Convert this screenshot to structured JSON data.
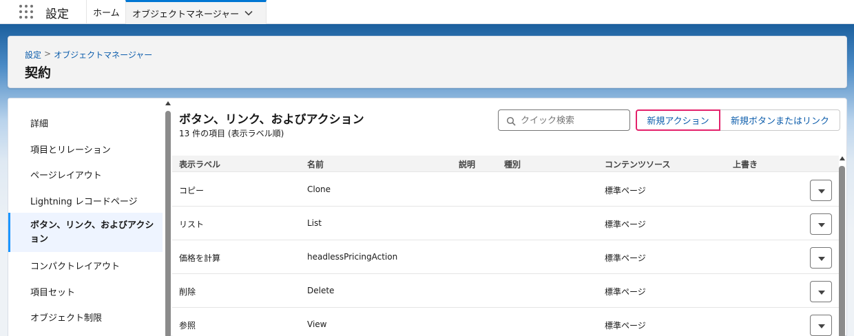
{
  "topbar": {
    "app_name": "設定",
    "tabs": [
      {
        "label": "ホーム"
      },
      {
        "label": "オブジェクトマネージャー"
      }
    ]
  },
  "header": {
    "breadcrumb": [
      {
        "label": "設定"
      },
      {
        "label": "オブジェクトマネージャー"
      }
    ],
    "breadcrumb_sep": ">",
    "title": "契約"
  },
  "sidebar": {
    "items": [
      {
        "label": "詳細"
      },
      {
        "label": "項目とリレーション"
      },
      {
        "label": "ページレイアウト"
      },
      {
        "label": "Lightning レコードページ"
      },
      {
        "label": "ボタン、リンク、およびアクション"
      },
      {
        "label": "コンパクトレイアウト"
      },
      {
        "label": "項目セット"
      },
      {
        "label": "オブジェクト制限"
      }
    ],
    "active_index": 4
  },
  "section": {
    "title": "ボタン、リンク、およびアクション",
    "subtitle": "13 件の項目 (表示ラベル順)",
    "search_placeholder": "クイック検索",
    "new_action_label": "新規アクション",
    "new_button_label": "新規ボタンまたはリンク"
  },
  "table": {
    "columns": [
      "表示ラベル",
      "名前",
      "説明",
      "種別",
      "コンテンツソース",
      "上書き"
    ],
    "rows": [
      {
        "label": "コピー",
        "name": "Clone",
        "description": "",
        "type": "",
        "source": "標準ページ",
        "override": ""
      },
      {
        "label": "リスト",
        "name": "List",
        "description": "",
        "type": "",
        "source": "標準ページ",
        "override": ""
      },
      {
        "label": "価格を計算",
        "name": "headlessPricingAction",
        "description": "",
        "type": "",
        "source": "標準ページ",
        "override": ""
      },
      {
        "label": "削除",
        "name": "Delete",
        "description": "",
        "type": "",
        "source": "標準ページ",
        "override": ""
      },
      {
        "label": "参照",
        "name": "View",
        "description": "",
        "type": "",
        "source": "標準ページ",
        "override": ""
      }
    ]
  },
  "colors": {
    "link": "#0b5cab",
    "highlight_border": "#e3206a",
    "active_bar": "#1b96ff"
  },
  "icons": {
    "app_launcher": "waffle-icon",
    "tab_menu": "chevron-down-icon",
    "search": "search-icon",
    "row_action": "caret-down-icon"
  }
}
